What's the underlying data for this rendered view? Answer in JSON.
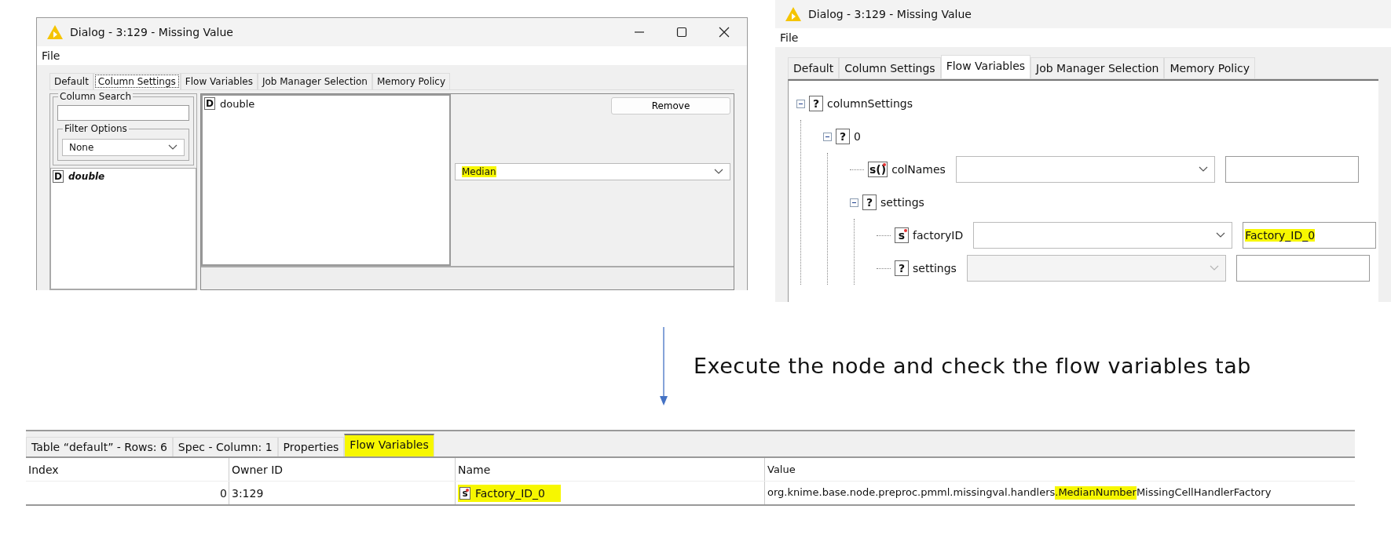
{
  "dialog_column_settings": {
    "title": "Dialog - 3:129 - Missing Value",
    "menu": [
      "File"
    ],
    "tabs": [
      {
        "label": "Default",
        "selected": false
      },
      {
        "label": "Column Settings",
        "selected": true
      },
      {
        "label": "Flow Variables",
        "selected": false
      },
      {
        "label": "Job Manager Selection",
        "selected": false
      },
      {
        "label": "Memory Policy",
        "selected": false
      }
    ],
    "column_search": {
      "label": "Column Search"
    },
    "filter_options": {
      "label": "Filter Options",
      "value": "None"
    },
    "column_list": [
      {
        "badge": "D",
        "name": "double"
      }
    ],
    "selected_columns": [
      {
        "badge": "D",
        "name": "double"
      }
    ],
    "remove_button": "Remove",
    "handler": {
      "value": "Median",
      "highlighted": true
    }
  },
  "dialog_flow_variables": {
    "title": "Dialog - 3:129 - Missing Value",
    "menu": [
      "File"
    ],
    "tabs": [
      {
        "label": "Default",
        "selected": false
      },
      {
        "label": "Column Settings",
        "selected": false
      },
      {
        "label": "Flow Variables",
        "selected": true
      },
      {
        "label": "Job Manager Selection",
        "selected": false
      },
      {
        "label": "Memory Policy",
        "selected": false
      }
    ],
    "tree": [
      {
        "badge": "?",
        "label": "columnSettings",
        "expanded": true,
        "children": [
          {
            "badge": "?",
            "label": "0",
            "expanded": true,
            "children": [
              {
                "badge": "s()",
                "dot": true,
                "label": "colNames",
                "control": {
                  "disabled": false
                }
              },
              {
                "badge": "?",
                "label": "settings",
                "expanded": true,
                "children": [
                  {
                    "badge": "s",
                    "dot": true,
                    "label": "factoryID",
                    "control": {
                      "disabled": false,
                      "value": "Factory_ID_0",
                      "highlighted": true
                    }
                  },
                  {
                    "badge": "?",
                    "label": "settings",
                    "control": {
                      "disabled": true
                    }
                  }
                ]
              }
            ]
          }
        ]
      }
    ]
  },
  "annotation": {
    "text": "Execute the node and check the flow variables tab"
  },
  "output_view": {
    "tabs": [
      {
        "label": "Table “default” - Rows: 6",
        "selected": false,
        "highlighted": false
      },
      {
        "label": "Spec - Column: 1",
        "selected": false,
        "highlighted": false
      },
      {
        "label": "Properties",
        "selected": false,
        "highlighted": false
      },
      {
        "label": "Flow Variables",
        "selected": true,
        "highlighted": true
      }
    ],
    "table": {
      "columns": [
        "Index",
        "Owner ID",
        "Name",
        "Value"
      ],
      "rows": [
        {
          "index": "0",
          "owner_id": "3:129",
          "name": {
            "badge": "s",
            "dot": true,
            "text": "Factory_ID_0",
            "highlighted": true
          },
          "value": [
            {
              "text": "org.knime.base.node.preproc.pmml.missingval.handlers",
              "highlighted": false
            },
            {
              "text": ".MedianNumber",
              "highlighted": true
            },
            {
              "text": "MissingCellHandlerFactory",
              "highlighted": false
            }
          ]
        }
      ]
    }
  }
}
